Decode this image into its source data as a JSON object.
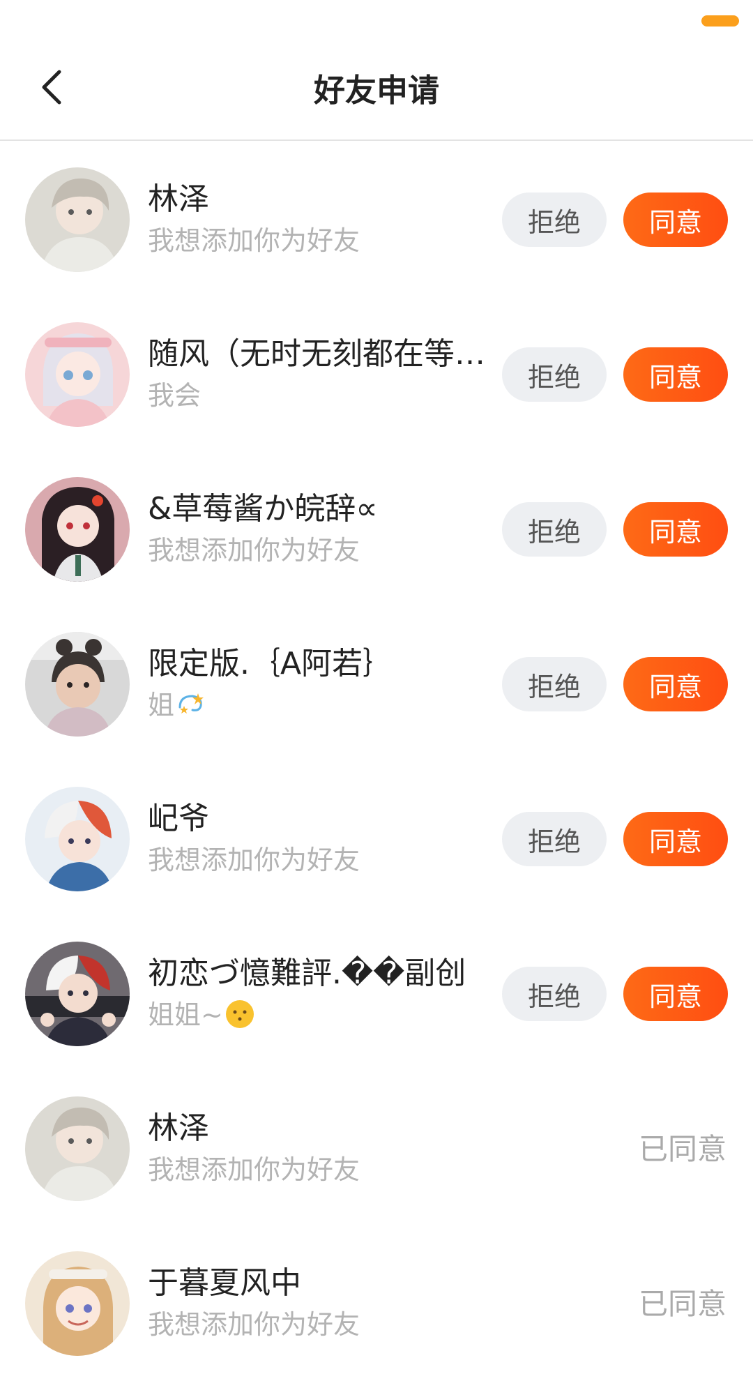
{
  "header": {
    "title": "好友申请",
    "back_icon": "chevron-left-icon"
  },
  "colors": {
    "accent": "#ff5a14",
    "status_accent": "#fb9f1c",
    "reject_bg": "#edeff2"
  },
  "requests": [
    {
      "name": "林泽",
      "message": "我想添加你为好友",
      "reject_label": "拒绝",
      "accept_label": "同意",
      "status": "pending"
    },
    {
      "name": "随风（无时无刻都在等…",
      "message": "我会",
      "reject_label": "拒绝",
      "accept_label": "同意",
      "status": "pending"
    },
    {
      "name": "&草莓酱か皖辞∝",
      "message": "我想添加你为好友",
      "reject_label": "拒绝",
      "accept_label": "同意",
      "status": "pending"
    },
    {
      "name": "限定版.｛A阿若｝",
      "message": "姐",
      "message_icon": "dizzy-star-icon",
      "reject_label": "拒绝",
      "accept_label": "同意",
      "status": "pending"
    },
    {
      "name": "屺爷",
      "message": "我想添加你为好友",
      "reject_label": "拒绝",
      "accept_label": "同意",
      "status": "pending"
    },
    {
      "name": "初恋づ憶難評.��副创",
      "message": "姐姐~",
      "message_icon": "smiley-face-icon",
      "reject_label": "拒绝",
      "accept_label": "同意",
      "status": "pending"
    },
    {
      "name": "林泽",
      "message": "我想添加你为好友",
      "status_label": "已同意",
      "status": "accepted"
    },
    {
      "name": "于暮夏风中",
      "message": "我想添加你为好友",
      "status_label": "已同意",
      "status": "accepted"
    }
  ]
}
